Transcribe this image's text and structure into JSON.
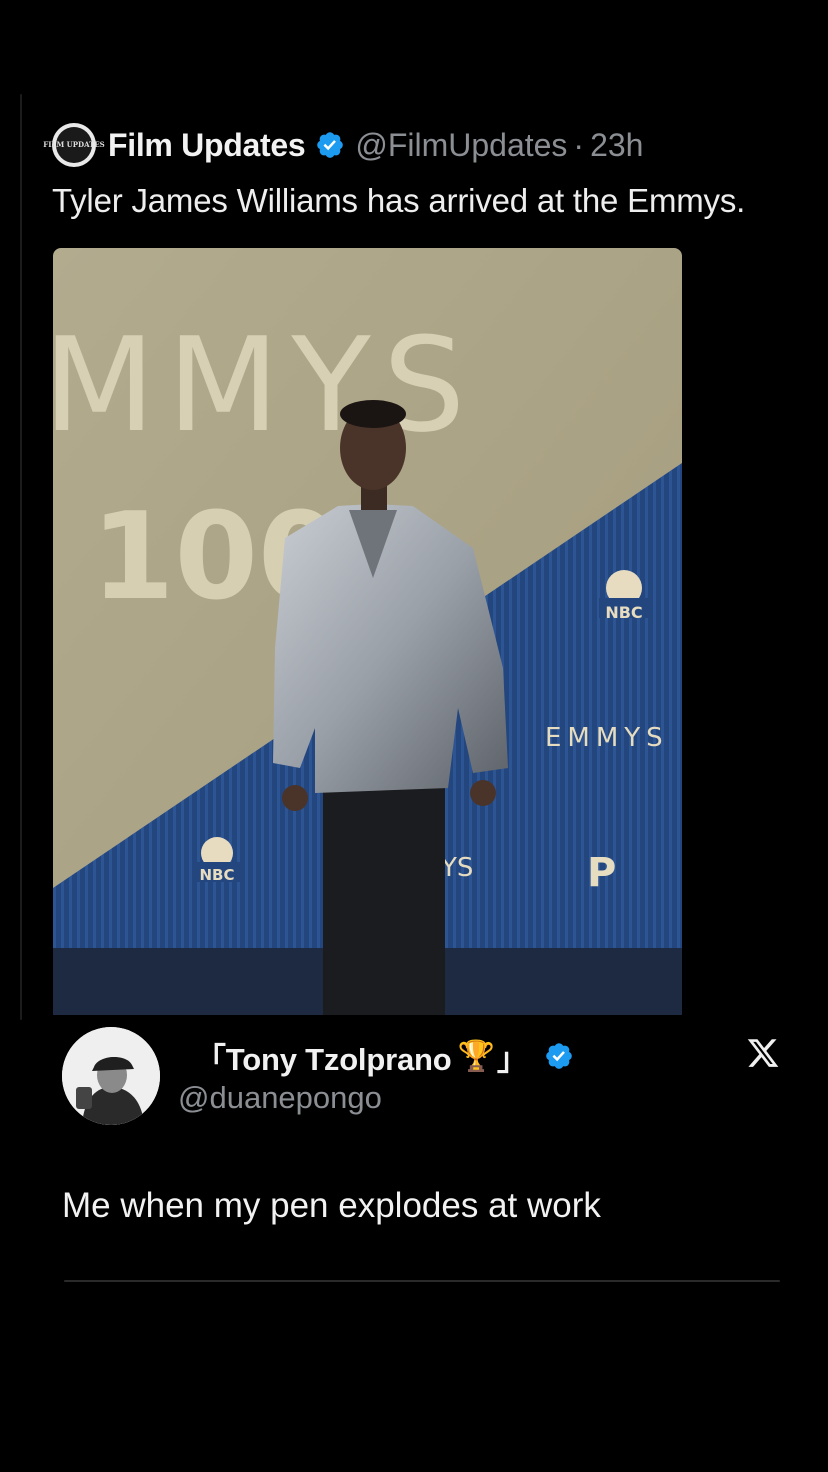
{
  "quoted_post": {
    "author_name": "Film Updates",
    "avatar_text": "FILM UPDATES",
    "handle": "@FilmUpdates",
    "separator": "·",
    "time": "23h",
    "text": "Tyler James Williams has arrived at the Emmys.",
    "media": {
      "backdrop_text_large": "MMYS",
      "backdrop_number": "100",
      "logo_label_1": "NBC",
      "logo_label_2": "NBC",
      "wall_text_1": "EMMYS",
      "wall_text_2": "YS",
      "sponsor_mark": "P"
    }
  },
  "reply_card": {
    "display_name": "「Tony Tzolprano",
    "trophy_glyph": "🏆",
    "closing_bracket": "」",
    "handle": "@duanepongo",
    "text": "Me when my pen explodes at work",
    "platform_icon": "x-logo-icon"
  },
  "colors": {
    "background": "#000000",
    "verified_blue": "#1d9bf0",
    "secondary_text": "#8b8f94",
    "primary_text": "#e7e9ea"
  }
}
